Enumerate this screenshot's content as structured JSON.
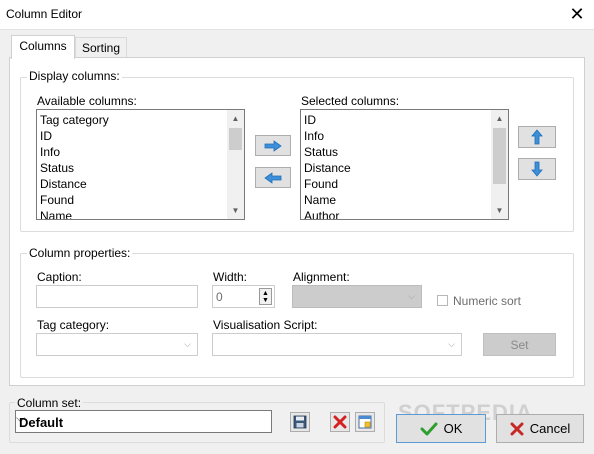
{
  "window": {
    "title": "Column Editor",
    "close_glyph": "✕"
  },
  "tabs": [
    {
      "label": "Columns",
      "active": true
    },
    {
      "label": "Sorting",
      "active": false
    }
  ],
  "display_columns": {
    "legend": "Display columns:",
    "available_label": "Available columns:",
    "available_items": [
      "Tag category",
      "ID",
      "Info",
      "Status",
      "Distance",
      "Found",
      "Name"
    ],
    "selected_label": "Selected columns:",
    "selected_items": [
      "ID",
      "Info",
      "Status",
      "Distance",
      "Found",
      "Name",
      "Author"
    ],
    "add_icon": "arrow-right-icon",
    "remove_icon": "arrow-left-icon",
    "move_up_icon": "arrow-up-icon",
    "move_down_icon": "arrow-down-icon"
  },
  "column_properties": {
    "legend": "Column properties:",
    "caption_label": "Caption:",
    "caption_value": "",
    "width_label": "Width:",
    "width_value": "0",
    "alignment_label": "Alignment:",
    "alignment_value": "",
    "numeric_sort_label": "Numeric sort",
    "numeric_sort_checked": false,
    "tag_category_label": "Tag category:",
    "tag_category_value": "",
    "script_label": "Visualisation Script:",
    "script_value": "",
    "set_label": "Set"
  },
  "footer": {
    "column_set_label": "Column set:",
    "column_set_value": "Default",
    "save_icon": "floppy-disk-icon",
    "delete_icon": "red-x-delete-icon",
    "properties_icon": "window-properties-icon",
    "ok_label": "OK",
    "cancel_label": "Cancel",
    "watermark": "SOFTPEDIA"
  },
  "colors": {
    "accent_blue": "#3c8fd8",
    "ok_green": "#2e9e2e",
    "cancel_red": "#c62828",
    "panel_bg": "#ffffff",
    "window_bg": "#f0f0f0"
  }
}
